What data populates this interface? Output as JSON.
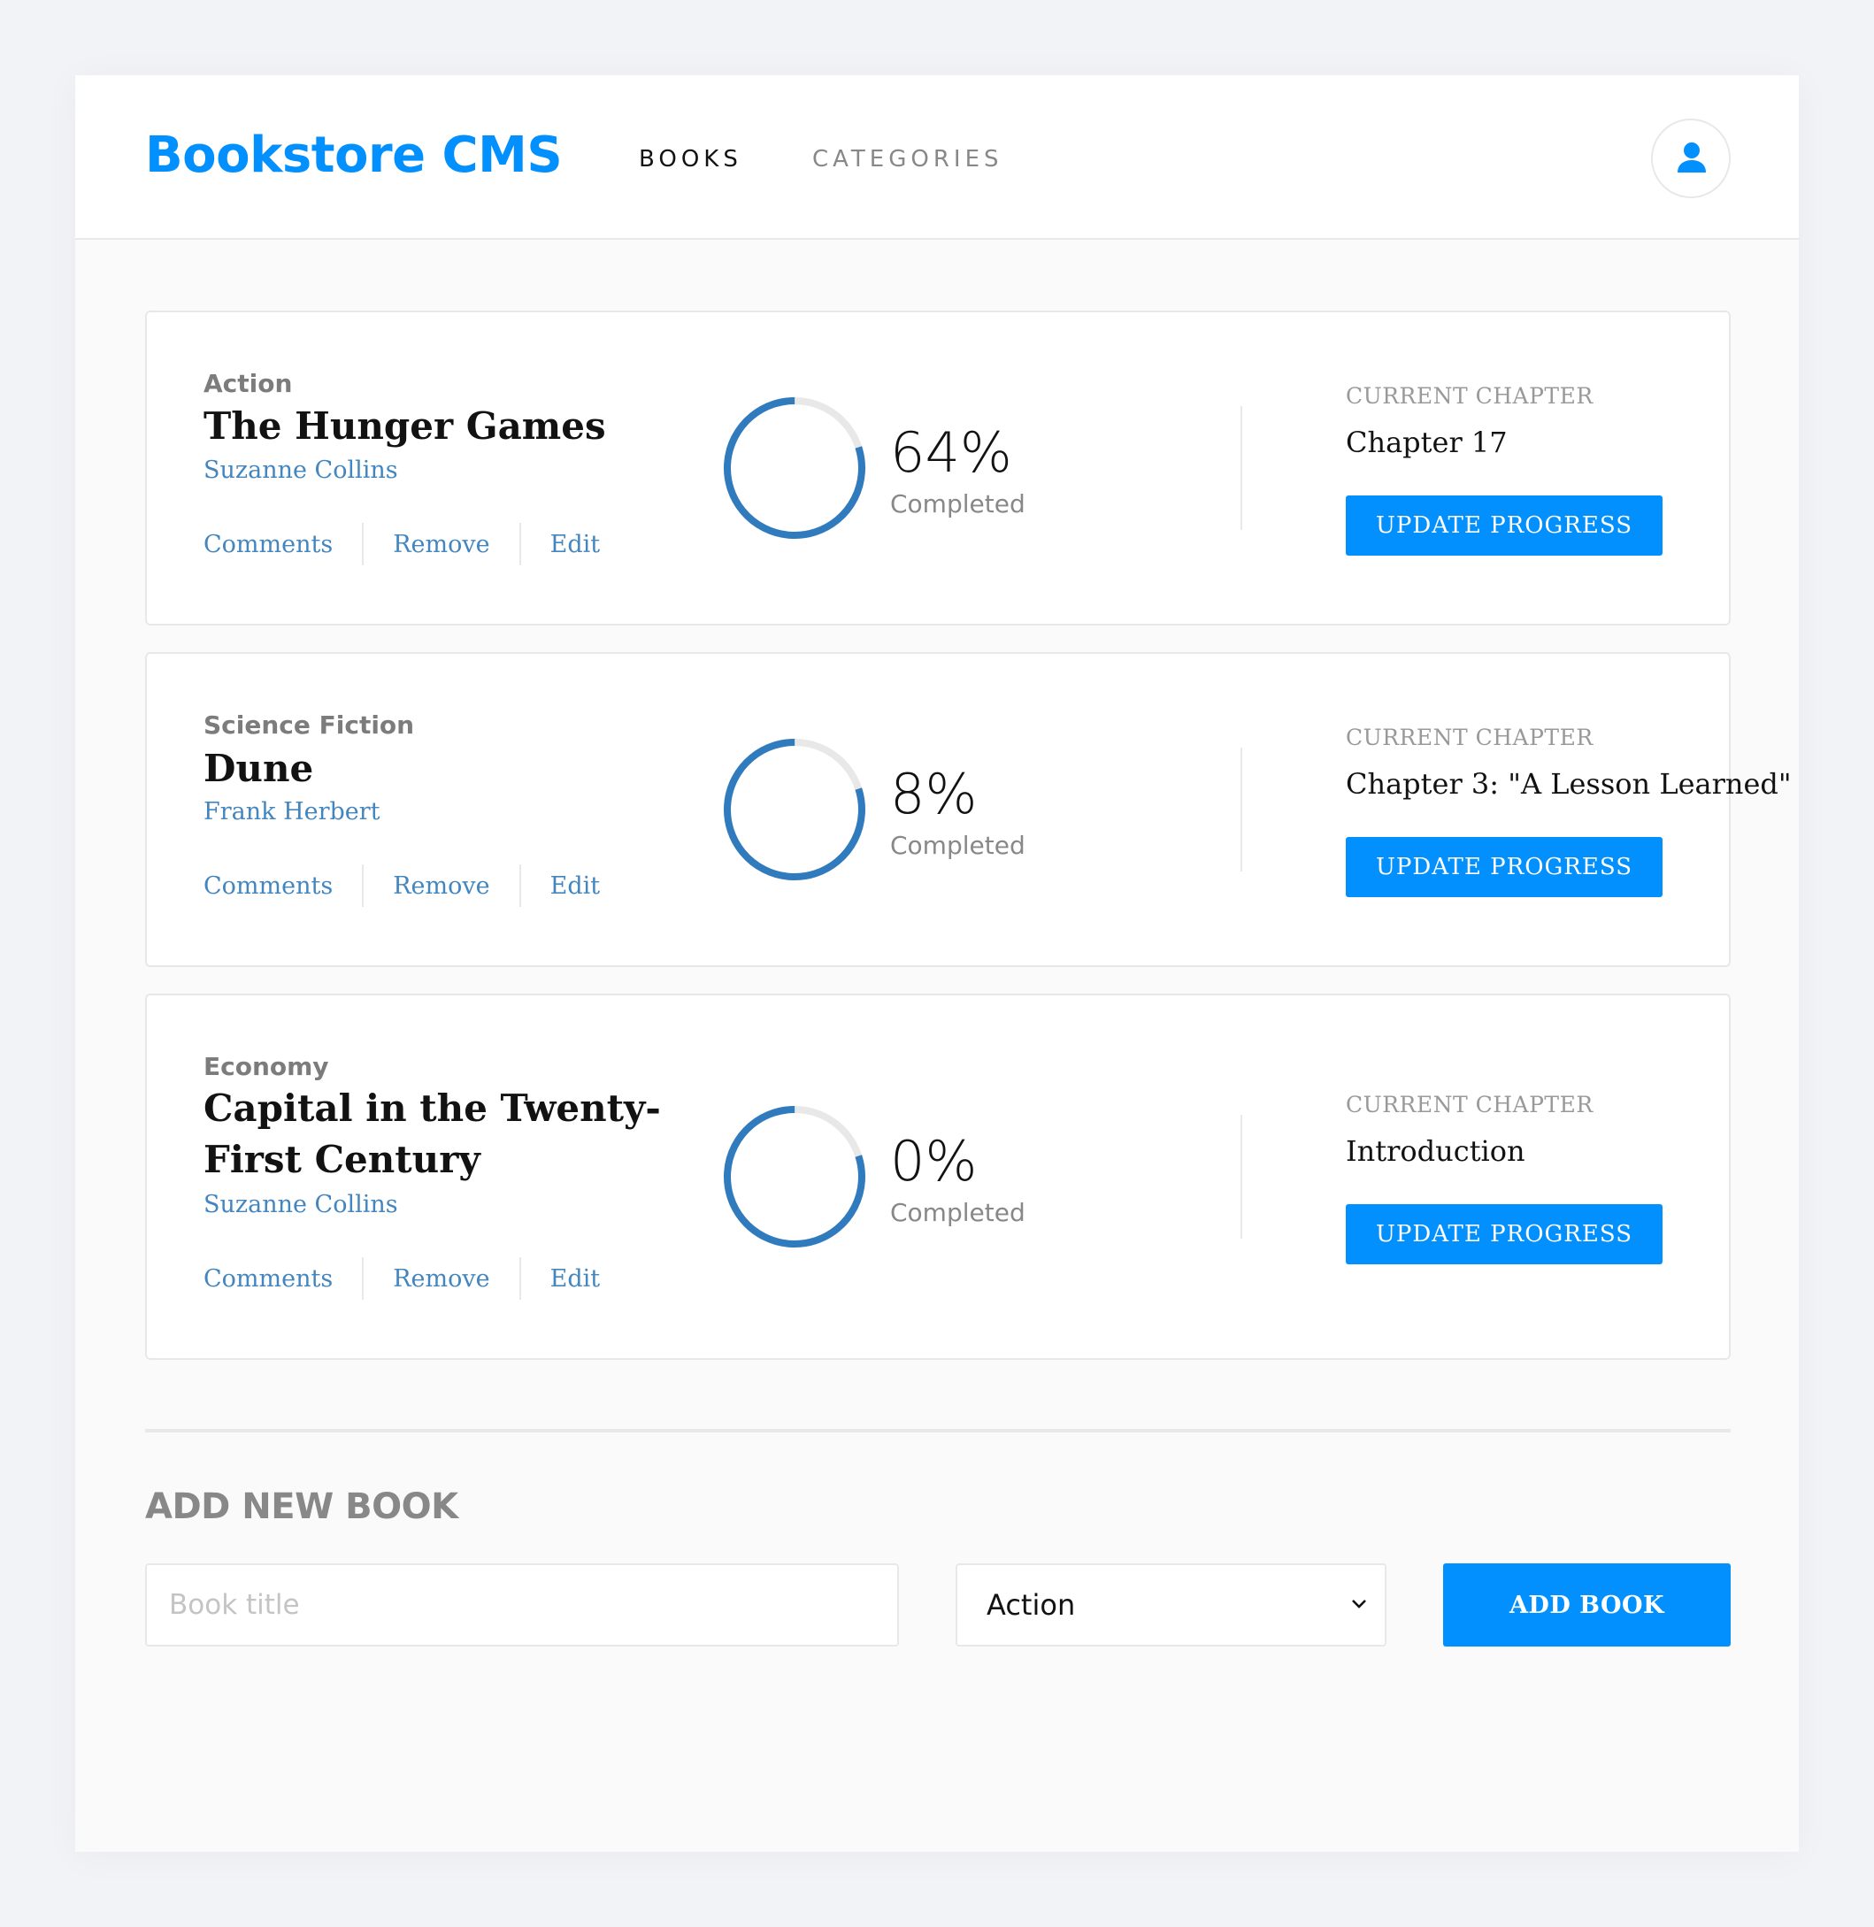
{
  "header": {
    "logo": "Bookstore CMS",
    "nav": {
      "books": "BOOKS",
      "categories": "CATEGORIES"
    },
    "user_icon": "user-icon"
  },
  "books": [
    {
      "category": "Action",
      "title": "The Hunger Games",
      "author": "Suzanne Collins",
      "actions": {
        "comments": "Comments",
        "remove": "Remove",
        "edit": "Edit"
      },
      "progress_percent": 64,
      "progress_label": "64%",
      "completed_label": "Completed",
      "current_chapter_label": "CURRENT CHAPTER",
      "current_chapter": "Chapter 17",
      "update_button": "UPDATE PROGRESS"
    },
    {
      "category": "Science Fiction",
      "title": "Dune",
      "author": "Frank Herbert",
      "actions": {
        "comments": "Comments",
        "remove": "Remove",
        "edit": "Edit"
      },
      "progress_percent": 8,
      "progress_label": "8%",
      "completed_label": "Completed",
      "current_chapter_label": "CURRENT CHAPTER",
      "current_chapter": "Chapter 3: \"A Lesson Learned\"",
      "update_button": "UPDATE PROGRESS"
    },
    {
      "category": "Economy",
      "title": "Capital in the Twenty-First Century",
      "author": "Suzanne Collins",
      "actions": {
        "comments": "Comments",
        "remove": "Remove",
        "edit": "Edit"
      },
      "progress_percent": 0,
      "progress_label": "0%",
      "completed_label": "Completed",
      "current_chapter_label": "CURRENT CHAPTER",
      "current_chapter": "Introduction",
      "update_button": "UPDATE PROGRESS"
    }
  ],
  "form": {
    "title": "ADD NEW BOOK",
    "title_placeholder": "Book title",
    "category_selected": "Action",
    "add_button": "ADD BOOK"
  },
  "colors": {
    "accent": "#0290ff",
    "link": "#4386bf",
    "ring": "#307bbe",
    "ring_track": "#e8e8e8"
  }
}
